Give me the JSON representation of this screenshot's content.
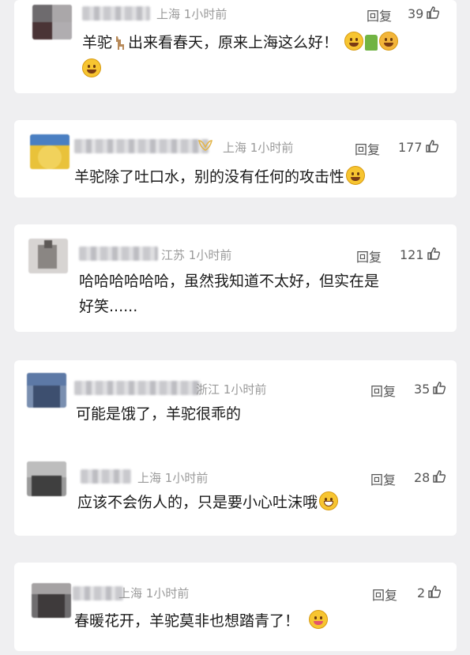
{
  "comments": [
    {
      "location": "上海",
      "time": "1小时前",
      "reply": "回复",
      "likes": "39",
      "text_a": "羊驼",
      "llama_icon": "llama-emoji-icon",
      "text_b": "出来看春天，原来上海这么好！",
      "emojis": [
        "laughing-emoji-icon",
        "thumbs-up-emoji-icon",
        "clapping-emoji-icon",
        "grin-emoji-icon"
      ]
    },
    {
      "location": "上海",
      "time": "1小时前",
      "reply": "回复",
      "likes": "177",
      "badge_icon": "crown-badge-icon",
      "text": "羊驼除了吐口水，别的没有任何的攻击性",
      "emojis": [
        "rolling-laugh-emoji-icon"
      ]
    },
    {
      "location": "江苏",
      "time": "1小时前",
      "reply": "回复",
      "likes": "121",
      "text_line1": "哈哈哈哈哈哈，虽然我知道不太好，但实在是",
      "text_line2": "好笑......"
    },
    {
      "location": "浙江",
      "time": "1小时前",
      "reply": "回复",
      "likes": "35",
      "text": "可能是饿了，羊驼很乖的",
      "subreply": {
        "location": "上海",
        "time": "1小时前",
        "reply": "回复",
        "likes": "28",
        "text": "应该不会伤人的，只是要小心吐沫哦",
        "emojis": [
          "grinning-teeth-emoji-icon"
        ]
      }
    },
    {
      "location": "上海",
      "time": "1小时前",
      "reply": "回复",
      "likes": "2",
      "text": "春暖花开，羊驼莫非也想踏青了！",
      "emojis": [
        "wink-tongue-emoji-icon"
      ]
    }
  ],
  "colors": {
    "background": "#efeff1",
    "card": "#ffffff",
    "meta_text": "#9a9a9a",
    "body_text": "#1a1a1a"
  }
}
